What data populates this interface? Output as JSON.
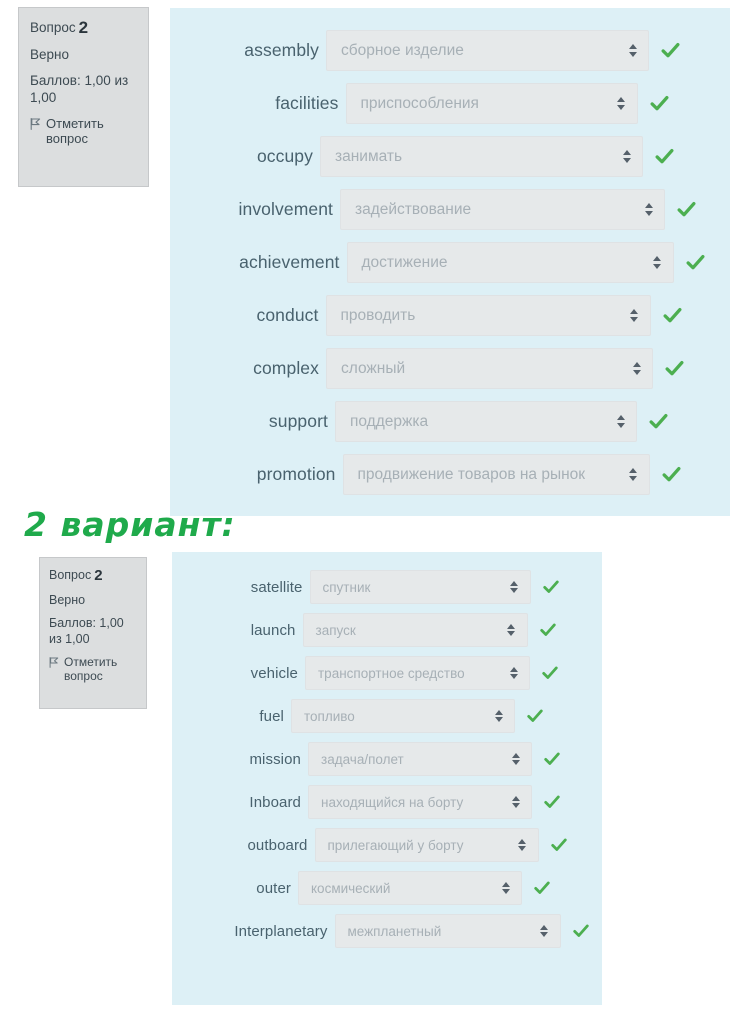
{
  "colors": {
    "panel_bg": "#ddf0f6",
    "select_bg": "#e6e9ea",
    "info_bg": "#dcdedf",
    "tick_green": "#4caf50",
    "heading_green": "#1faa4b",
    "term_text": "#49626e",
    "value_text": "#a7b0b6"
  },
  "blocks": [
    {
      "info": {
        "question_label": "Вопрос",
        "question_number": "2",
        "state": "Верно",
        "marks": "Баллов: 1,00 из 1,00",
        "flag_icon": "flag-outline-icon",
        "flag_label": "Отметить вопрос"
      },
      "rows": [
        {
          "term": "assembly",
          "value": "сборное изделие",
          "status": "correct",
          "status_icon": "check-icon",
          "term_w": 100,
          "sel_w": 323
        },
        {
          "term": "facilities",
          "value": "приспособления",
          "status": "correct",
          "status_icon": "check-icon",
          "term_w": 108,
          "sel_w": 292
        },
        {
          "term": "occupy",
          "value": "занимать",
          "status": "correct",
          "status_icon": "check-icon",
          "term_w": 88,
          "sel_w": 323
        },
        {
          "term": "involvement",
          "value": "задействование",
          "status": "correct",
          "status_icon": "check-icon",
          "term_w": 130,
          "sel_w": 325
        },
        {
          "term": "achievement",
          "value": "достижение",
          "status": "correct",
          "status_icon": "check-icon",
          "term_w": 145,
          "sel_w": 327
        },
        {
          "term": "conduct",
          "value": "проводить",
          "status": "correct",
          "status_icon": "check-icon",
          "term_w": 101,
          "sel_w": 325
        },
        {
          "term": "complex",
          "value": "сложный",
          "status": "correct",
          "status_icon": "check-icon",
          "term_w": 104,
          "sel_w": 327
        },
        {
          "term": "support",
          "value": "поддержка",
          "status": "correct",
          "status_icon": "check-icon",
          "term_w": 97,
          "sel_w": 302
        },
        {
          "term": "promotion",
          "value": "продвижение товаров на рынок",
          "status": "correct",
          "status_icon": "check-icon",
          "term_w": 117,
          "sel_w": 307
        }
      ]
    },
    {
      "info": {
        "question_label": "Вопрос",
        "question_number": "2",
        "state": "Верно",
        "marks": "Баллов: 1,00 из 1,00",
        "flag_icon": "flag-outline-icon",
        "flag_label": "Отметить вопрос"
      },
      "rows": [
        {
          "term": "satellite",
          "value": "спутник",
          "status": "correct",
          "status_icon": "check-icon",
          "term_w": 88,
          "sel_w": 221
        },
        {
          "term": "launch",
          "value": "запуск",
          "status": "correct",
          "status_icon": "check-icon",
          "term_w": 78,
          "sel_w": 225
        },
        {
          "term": "vehicle",
          "value": "транспортное средство",
          "status": "correct",
          "status_icon": "check-icon",
          "term_w": 83,
          "sel_w": 225
        },
        {
          "term": "fuel",
          "value": "топливо",
          "status": "correct",
          "status_icon": "check-icon",
          "term_w": 54,
          "sel_w": 224
        },
        {
          "term": "mission",
          "value": "задача/полет",
          "status": "correct",
          "status_icon": "check-icon",
          "term_w": 88,
          "sel_w": 224
        },
        {
          "term": "Inboard",
          "value": "находящийся на борту",
          "status": "correct",
          "status_icon": "check-icon",
          "term_w": 88,
          "sel_w": 224
        },
        {
          "term": "outboard",
          "value": "прилегающий у борту",
          "status": "correct",
          "status_icon": "check-icon",
          "term_w": 101,
          "sel_w": 224
        },
        {
          "term": "outer",
          "value": "космический",
          "status": "correct",
          "status_icon": "check-icon",
          "term_w": 68,
          "sel_w": 224
        },
        {
          "term": "Interplanetary",
          "value": "межпланетный",
          "status": "correct",
          "status_icon": "check-icon",
          "term_w": 143,
          "sel_w": 226
        }
      ]
    }
  ],
  "variant_heading": "2 вариант:"
}
